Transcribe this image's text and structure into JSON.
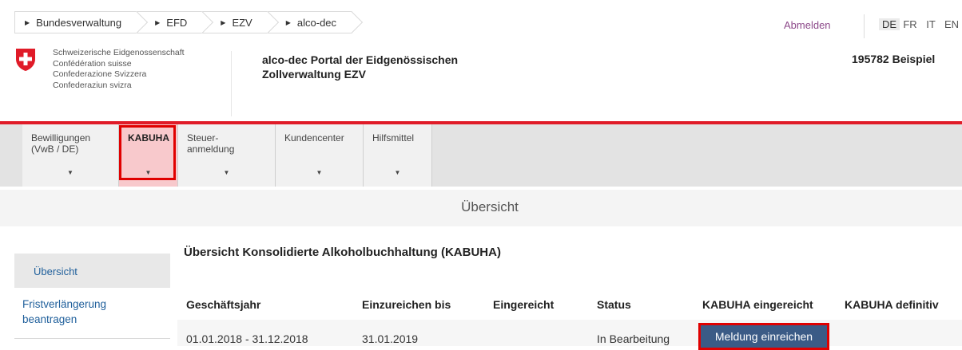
{
  "breadcrumb": [
    "Bundesverwaltung",
    "EFD",
    "EZV",
    "alco-dec"
  ],
  "header": {
    "logout": "Abmelden",
    "languages": [
      "DE",
      "FR",
      "IT",
      "EN"
    ],
    "active_language": "DE",
    "federation": [
      "Schweizerische Eidgenossenschaft",
      "Confédération suisse",
      "Confederazione Svizzera",
      "Confederaziun svizra"
    ],
    "portal_line1": "alco-dec Portal der Eidgenössischen",
    "portal_line2": "Zollverwaltung EZV",
    "company": "195782 Beispiel"
  },
  "nav": [
    {
      "line1": "Bewilligungen",
      "line2": "(VwB / DE)",
      "active": false
    },
    {
      "line1": "KABUHA",
      "line2": "",
      "active": true
    },
    {
      "line1": "Steuer-",
      "line2": "anmeldung",
      "active": false
    },
    {
      "line1": "Kundencenter",
      "line2": "",
      "active": false
    },
    {
      "line1": "Hilfsmittel",
      "line2": "",
      "active": false
    }
  ],
  "page_title": "Übersicht",
  "sidebar": {
    "items": [
      "Übersicht",
      "Fristverlängerung",
      "beantragen"
    ]
  },
  "main": {
    "heading": "Übersicht Konsolidierte Alkoholbuchhaltung (KABUHA)",
    "columns": [
      "Geschäftsjahr",
      "Einzureichen bis",
      "Eingereicht",
      "Status",
      "KABUHA eingereicht",
      "KABUHA definitiv"
    ],
    "row": {
      "year": "01.01.2018 - 31.12.2018",
      "due": "31.01.2019",
      "submitted": "",
      "status": "In Bearbeitung",
      "action": "Meldung einreichen"
    }
  },
  "colors": {
    "accent_red": "#e01b28",
    "link_blue": "#1f5f9b",
    "button_blue": "#3b5b86",
    "logout_purple": "#8d4a8a"
  }
}
